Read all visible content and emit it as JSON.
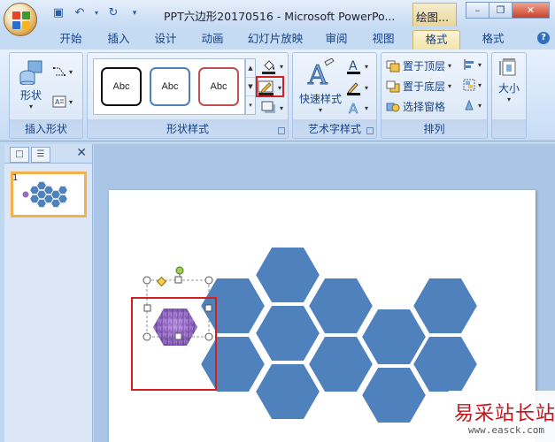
{
  "window": {
    "title": "PPT六边形20170516 - Microsoft PowerPo...",
    "context_title": "绘图..."
  },
  "tabs": [
    {
      "label": "开始"
    },
    {
      "label": "插入"
    },
    {
      "label": "设计"
    },
    {
      "label": "动画"
    },
    {
      "label": "幻灯片放映"
    },
    {
      "label": "审阅"
    },
    {
      "label": "视图"
    },
    {
      "label": "格式",
      "active": true
    },
    {
      "label": "格式"
    }
  ],
  "ribbon": {
    "insert_shapes": {
      "shape_label": "形状",
      "group_label": "插入形状"
    },
    "shape_styles": {
      "samples": [
        "Abc",
        "Abc",
        "Abc"
      ],
      "group_label": "形状样式"
    },
    "wordart": {
      "quick_styles_label": "快速样式",
      "group_label": "艺术字样式"
    },
    "arrange": {
      "bring_front": "置于顶层",
      "send_back": "置于底层",
      "selection_pane": "选择窗格",
      "group_label": "排列"
    },
    "size": {
      "label": "大小"
    }
  },
  "slides_pane": {
    "slide_number": "1"
  },
  "watermark": {
    "line1": "易采站长站",
    "line2": "www.easck.com"
  },
  "colors": {
    "hexagon_fill": "#4f81bd",
    "highlight_red": "#d21f1f",
    "thumb_border": "#f4b04a"
  }
}
